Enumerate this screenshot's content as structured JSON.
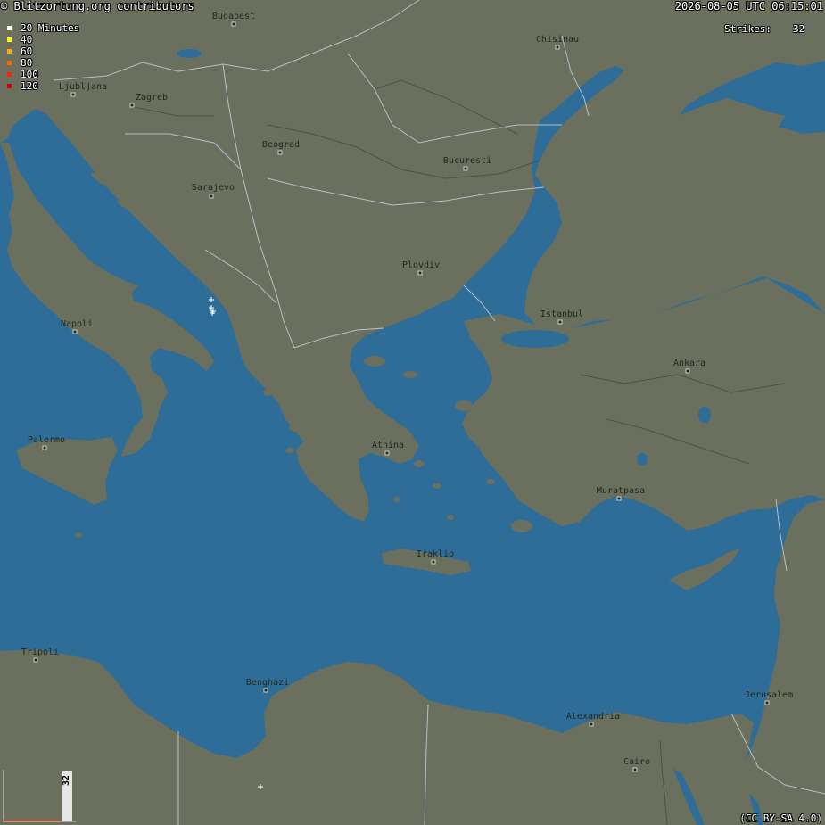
{
  "header": {
    "copyright": "© Blitzortung.org contributors",
    "timestamp": "2026-08-05 UTC 06:15:01"
  },
  "legend": {
    "items": [
      {
        "label": "20 Minutes",
        "color": "#ffffff"
      },
      {
        "label": "40",
        "color": "#ffff00"
      },
      {
        "label": "60",
        "color": "#ffaa00"
      },
      {
        "label": "80",
        "color": "#ff6600"
      },
      {
        "label": "100",
        "color": "#ff2200"
      },
      {
        "label": "120",
        "color": "#cc0000"
      }
    ]
  },
  "strikes": {
    "label": "Strikes:",
    "count": "32"
  },
  "histogram": {
    "value": "32"
  },
  "license": "(CC BY-SA 4.0)",
  "colors": {
    "sea": "#2f6d99",
    "land": "#6a6f5e",
    "border": "#c9ccd6",
    "river": "#3a4a44"
  },
  "cities": [
    {
      "name": "Budapest"
    },
    {
      "name": "Chisinau"
    },
    {
      "name": "Ljubljana"
    },
    {
      "name": "Zagreb"
    },
    {
      "name": "Beograd"
    },
    {
      "name": "Bucuresti"
    },
    {
      "name": "Sarajevo"
    },
    {
      "name": "Plovdiv"
    },
    {
      "name": "Istanbul"
    },
    {
      "name": "Napoli"
    },
    {
      "name": "Ankara"
    },
    {
      "name": "Athina"
    },
    {
      "name": "Palermo"
    },
    {
      "name": "Muratpasa"
    },
    {
      "name": "Iraklio"
    },
    {
      "name": "Tripoli"
    },
    {
      "name": "Benghazi"
    },
    {
      "name": "Jerusalem"
    },
    {
      "name": "Alexandria"
    },
    {
      "name": "Cairo"
    }
  ]
}
